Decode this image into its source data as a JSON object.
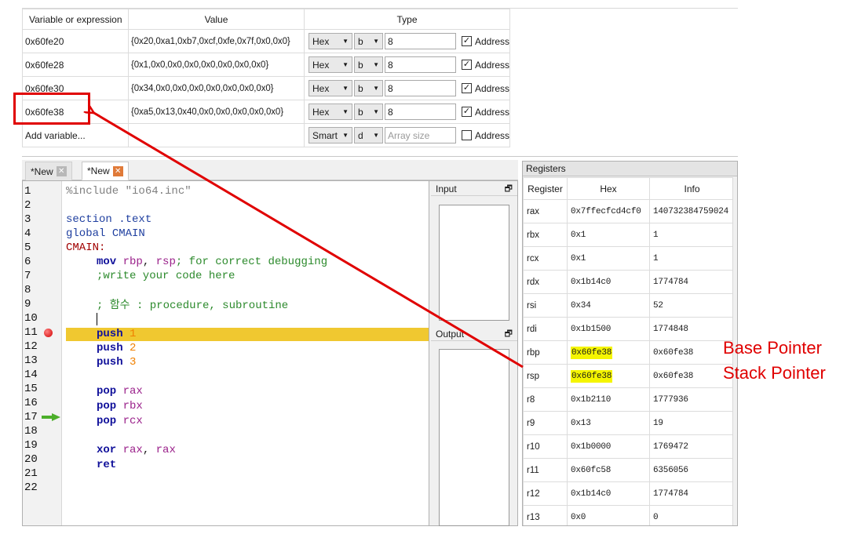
{
  "watch": {
    "headers": {
      "variable": "Variable or expression",
      "value": "Value",
      "type": "Type"
    },
    "rows": [
      {
        "variable": "0x60fe20",
        "value": "{0x20,0xa1,0xb7,0xcf,0xfe,0x7f,0x0,0x0}",
        "format": "Hex",
        "unit": "b",
        "size": "8",
        "address_checked": "☑",
        "address_label": "Address"
      },
      {
        "variable": "0x60fe28",
        "value": "{0x1,0x0,0x0,0x0,0x0,0x0,0x0,0x0}",
        "format": "Hex",
        "unit": "b",
        "size": "8",
        "address_checked": "☑",
        "address_label": "Address"
      },
      {
        "variable": "0x60fe30",
        "value": "{0x34,0x0,0x0,0x0,0x0,0x0,0x0,0x0}",
        "format": "Hex",
        "unit": "b",
        "size": "8",
        "address_checked": "☑",
        "address_label": "Address"
      },
      {
        "variable": "0x60fe38",
        "value": "{0xa5,0x13,0x40,0x0,0x0,0x0,0x0,0x0}",
        "format": "Hex",
        "unit": "b",
        "size": "8",
        "address_checked": "☑",
        "address_label": "Address"
      }
    ],
    "add_row": {
      "label": "Add variable...",
      "format": "Smart",
      "unit": "d",
      "size_placeholder": "Array size",
      "address_label": "Address"
    }
  },
  "tabs": [
    {
      "label": "*New"
    },
    {
      "label": "*New"
    }
  ],
  "editor": {
    "line_numbers": [
      "1",
      "2",
      "3",
      "4",
      "5",
      "6",
      "7",
      "8",
      "9",
      "10",
      "11",
      "12",
      "13",
      "14",
      "15",
      "16",
      "17",
      "18",
      "19",
      "20",
      "21",
      "22"
    ],
    "code": {
      "l1_directive": "%include",
      "l1_string": " \"io64.inc\"",
      "l3": "section .text",
      "l4_kw": "global ",
      "l4_label": "CMAIN",
      "l5": "CMAIN:",
      "l6_instr": "mov ",
      "l6_reg1": "rbp",
      "l6_sep": ", ",
      "l6_reg2": "rsp",
      "l6_comment": "; for correct debugging",
      "l7_comment": ";write your code here",
      "l9_comment": "; 함수 : procedure, subroutine",
      "l11_instr": "push ",
      "l11_num": "1",
      "l12_instr": "push ",
      "l12_num": "2",
      "l13_instr": "push ",
      "l13_num": "3",
      "l15_instr": "pop ",
      "l15_reg": "rax",
      "l16_instr": "pop ",
      "l16_reg": "rbx",
      "l17_instr": "pop ",
      "l17_reg": "rcx",
      "l19_instr": "xor ",
      "l19_reg1": "rax",
      "l19_sep": ", ",
      "l19_reg2": "rax",
      "l20_instr": "ret"
    }
  },
  "io": {
    "input_label": "Input",
    "output_label": "Output"
  },
  "registers": {
    "title": "Registers",
    "headers": {
      "register": "Register",
      "hex": "Hex",
      "info": "Info"
    },
    "rows": [
      {
        "name": "rax",
        "hex": "0x7ffecfcd4cf0",
        "info": "140732384759024"
      },
      {
        "name": "rbx",
        "hex": "0x1",
        "info": "1"
      },
      {
        "name": "rcx",
        "hex": "0x1",
        "info": "1"
      },
      {
        "name": "rdx",
        "hex": "0x1b14c0",
        "info": "1774784"
      },
      {
        "name": "rsi",
        "hex": "0x34",
        "info": "52"
      },
      {
        "name": "rdi",
        "hex": "0x1b1500",
        "info": "1774848"
      },
      {
        "name": "rbp",
        "hex": "0x60fe38",
        "info": "0x60fe38"
      },
      {
        "name": "rsp",
        "hex": "0x60fe38",
        "info": "0x60fe38"
      },
      {
        "name": "r8",
        "hex": "0x1b2110",
        "info": "1777936"
      },
      {
        "name": "r9",
        "hex": "0x13",
        "info": "19"
      },
      {
        "name": "r10",
        "hex": "0x1b0000",
        "info": "1769472"
      },
      {
        "name": "r11",
        "hex": "0x60fc58",
        "info": "6356056"
      },
      {
        "name": "r12",
        "hex": "0x1b14c0",
        "info": "1774784"
      },
      {
        "name": "r13",
        "hex": "0x0",
        "info": "0"
      }
    ]
  },
  "annotations": {
    "base_pointer": "Base Pointer",
    "stack_pointer": "Stack Pointer"
  },
  "colors": {
    "annotation_red": "#e00000",
    "current_line": "#f0c830",
    "highlight_yellow": "#f5f500",
    "breakpoint": "#d00000",
    "current_arrow": "#4caf2a"
  }
}
